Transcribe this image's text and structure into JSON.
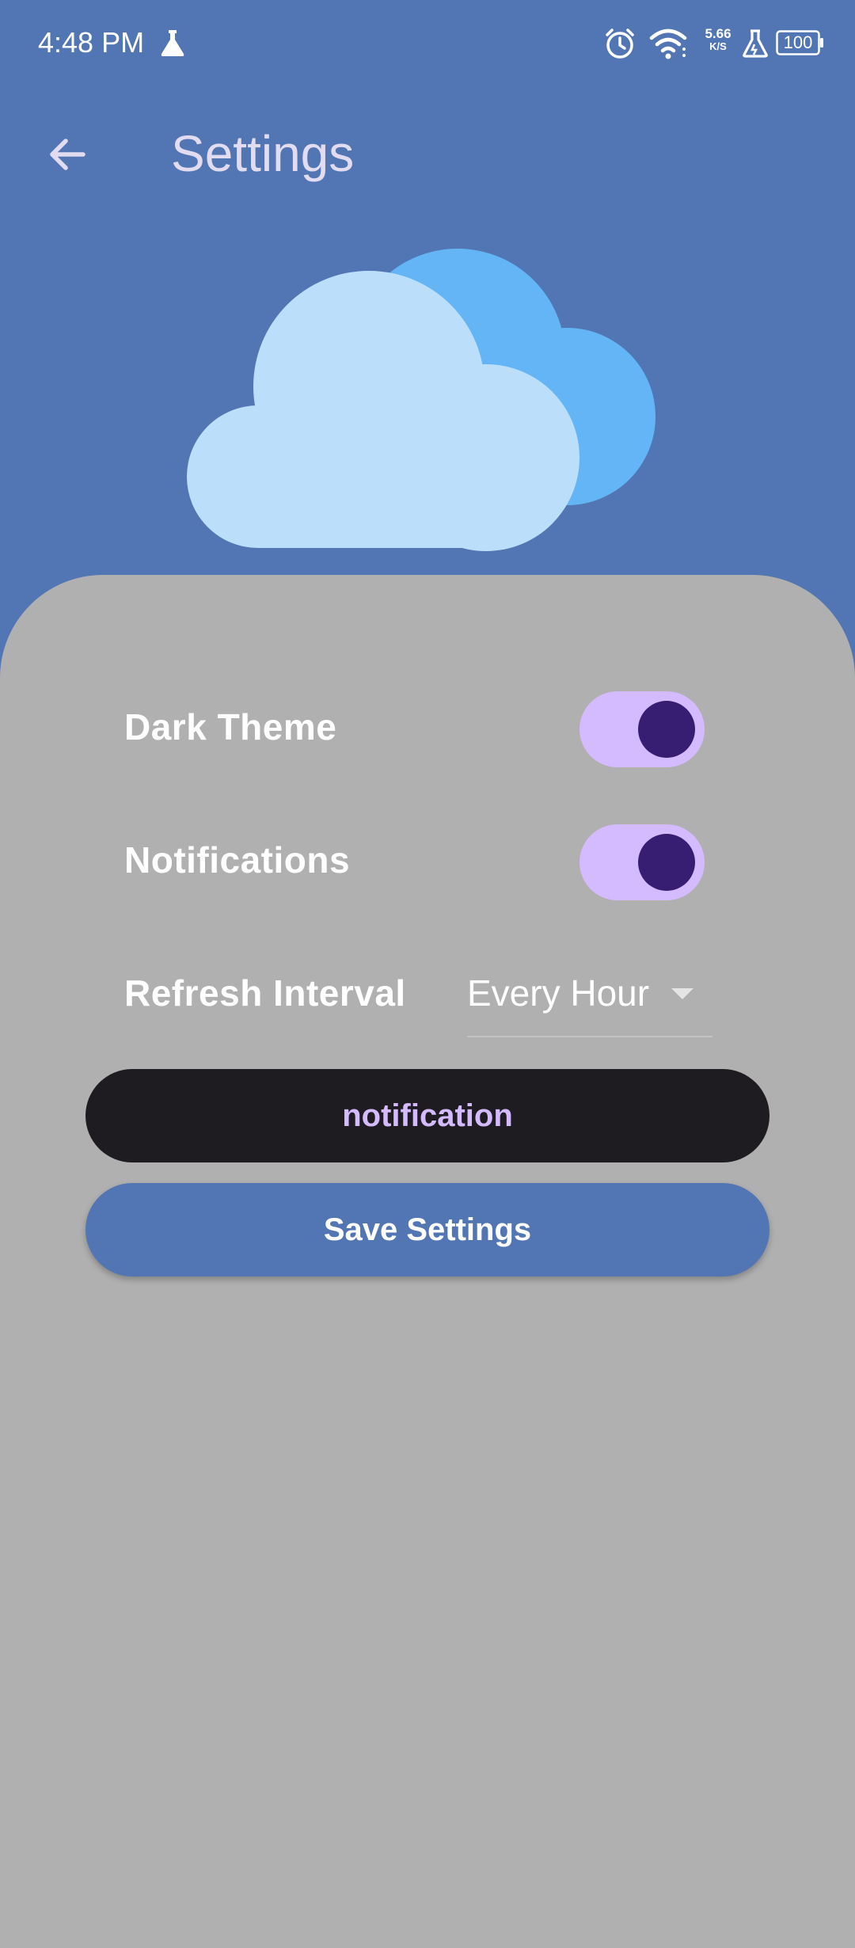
{
  "status_bar": {
    "time": "4:48 PM",
    "net_speed_value": "5.66",
    "net_speed_unit": "K/S",
    "battery": "100",
    "icons": [
      "flask-icon",
      "alarm-icon",
      "wifi-icon",
      "lab-icon",
      "battery-icon"
    ]
  },
  "app_bar": {
    "title": "Settings",
    "back_icon": "arrow-left-icon"
  },
  "hero": {
    "icon": "cloud-icon"
  },
  "settings": {
    "dark_theme": {
      "label": "Dark Theme",
      "enabled": true
    },
    "notifications": {
      "label": "Notifications",
      "enabled": true
    },
    "refresh_interval": {
      "label": "Refresh Interval",
      "value": "Every Hour"
    }
  },
  "buttons": {
    "notification_label": "notification",
    "save_label": "Save Settings"
  },
  "colors": {
    "primary": "#5276b3",
    "sheet": "#b0b0b0",
    "toggle_track": "#d4bbff",
    "toggle_thumb": "#381e72",
    "dark_button": "#1e1c21",
    "cloud_front": "#bbdefb",
    "cloud_back": "#64b5f6"
  }
}
